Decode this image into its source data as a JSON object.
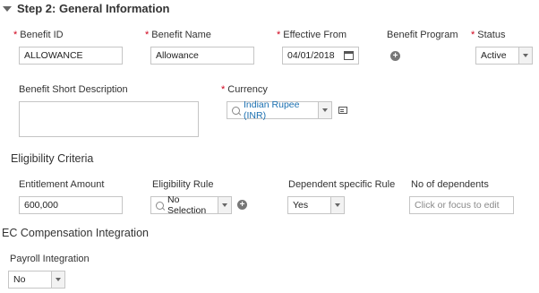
{
  "step": {
    "title": "Step 2: General Information"
  },
  "fields": {
    "benefit_id": {
      "label": "Benefit ID",
      "value": "ALLOWANCE",
      "required": true
    },
    "benefit_name": {
      "label": "Benefit Name",
      "value": "Allowance",
      "required": true
    },
    "effective_from": {
      "label": "Effective From",
      "value": "04/01/2018",
      "required": true
    },
    "benefit_program": {
      "label": "Benefit Program"
    },
    "status": {
      "label": "Status",
      "value": "Active",
      "required": true
    },
    "short_description": {
      "label": "Benefit Short Description",
      "value": ""
    },
    "currency": {
      "label": "Currency",
      "value": "Indian Rupee (INR)",
      "required": true
    }
  },
  "eligibility": {
    "title": "Eligibility Criteria",
    "entitlement_amount": {
      "label": "Entitlement Amount",
      "value": "600,000"
    },
    "eligibility_rule": {
      "label": "Eligibility Rule",
      "value": "No Selection"
    },
    "dependent_rule": {
      "label": "Dependent specific Rule",
      "value": "Yes"
    },
    "no_of_dependents": {
      "label": "No of dependents",
      "placeholder": "Click or focus to edit"
    }
  },
  "ec_compensation": {
    "title": "EC Compensation Integration",
    "payroll_integration": {
      "label": "Payroll Integration",
      "value": "No"
    }
  },
  "icons": {
    "section": "collapse-triangle-icon",
    "calendar": "calendar-icon",
    "add": "add-circle-icon",
    "search": "search-icon",
    "details": "details-card-icon"
  },
  "colors": {
    "required": "#d0021b",
    "link_blue": "#1a6fb0"
  }
}
